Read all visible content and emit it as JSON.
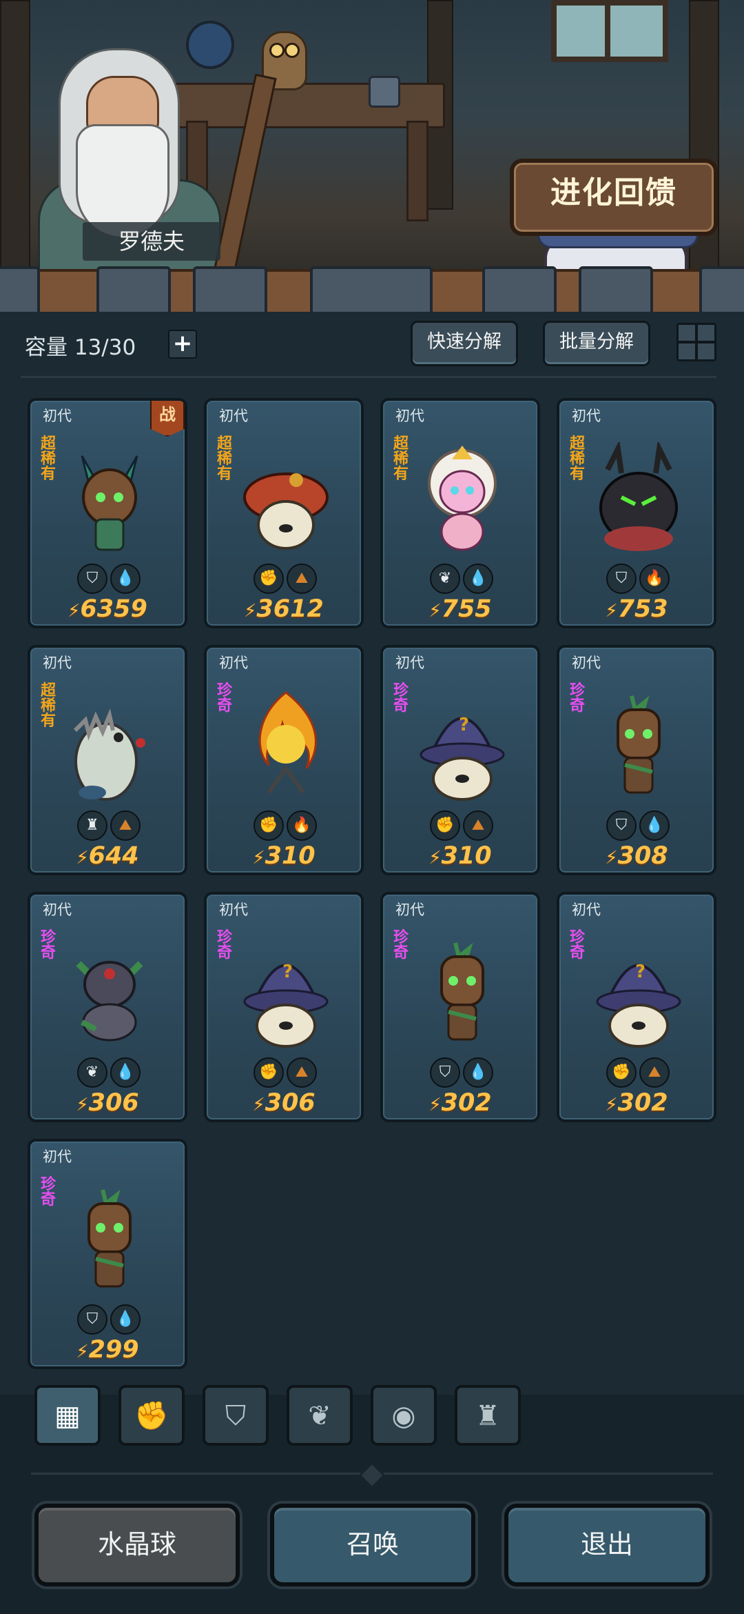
{
  "scene": {
    "npc_name": "罗德夫",
    "evolution_feedback_label": "进化回馈"
  },
  "toolbar": {
    "capacity_text": "容量 13/30",
    "plus_label": "+",
    "quick_dismantle_label": "快速分解",
    "batch_dismantle_label": "批量分解"
  },
  "cards": [
    {
      "generation": "初代",
      "rarity": "超稀有",
      "rarity_class": "r-super",
      "power": "6359",
      "in_battle": true,
      "battle_label": "战",
      "badges": [
        "shield-icon",
        "water-icon"
      ],
      "monster": "tree-knight"
    },
    {
      "generation": "初代",
      "rarity": "超稀有",
      "rarity_class": "r-super",
      "power": "3612",
      "in_battle": false,
      "badges": [
        "fist-icon",
        "earth-icon"
      ],
      "monster": "red-mushroom"
    },
    {
      "generation": "初代",
      "rarity": "超稀有",
      "rarity_class": "r-super",
      "power": "755",
      "in_battle": false,
      "badges": [
        "leaf-icon",
        "water-icon"
      ],
      "monster": "pink-larva"
    },
    {
      "generation": "初代",
      "rarity": "超稀有",
      "rarity_class": "r-super",
      "power": "753",
      "in_battle": false,
      "badges": [
        "shield-icon",
        "fire-icon"
      ],
      "monster": "dark-beast"
    },
    {
      "generation": "初代",
      "rarity": "超稀有",
      "rarity_class": "r-super",
      "power": "644",
      "in_battle": false,
      "badges": [
        "tower-icon",
        "earth-icon"
      ],
      "monster": "armored-rat"
    },
    {
      "generation": "初代",
      "rarity": "珍奇",
      "rarity_class": "r-rare",
      "power": "310",
      "in_battle": false,
      "badges": [
        "fist-icon",
        "fire-icon"
      ],
      "monster": "fire-spirit"
    },
    {
      "generation": "初代",
      "rarity": "珍奇",
      "rarity_class": "r-rare",
      "power": "310",
      "in_battle": false,
      "badges": [
        "fist-icon",
        "earth-icon"
      ],
      "monster": "wizard-mushroom"
    },
    {
      "generation": "初代",
      "rarity": "珍奇",
      "rarity_class": "r-rare",
      "power": "308",
      "in_battle": false,
      "badges": [
        "shield-icon",
        "water-icon"
      ],
      "monster": "sapling"
    },
    {
      "generation": "初代",
      "rarity": "珍奇",
      "rarity_class": "r-rare",
      "power": "306",
      "in_battle": false,
      "badges": [
        "leaf-icon",
        "water-icon"
      ],
      "monster": "green-larva"
    },
    {
      "generation": "初代",
      "rarity": "珍奇",
      "rarity_class": "r-rare",
      "power": "306",
      "in_battle": false,
      "badges": [
        "fist-icon",
        "earth-icon"
      ],
      "monster": "wizard-mushroom"
    },
    {
      "generation": "初代",
      "rarity": "珍奇",
      "rarity_class": "r-rare",
      "power": "302",
      "in_battle": false,
      "badges": [
        "shield-icon",
        "water-icon"
      ],
      "monster": "sapling"
    },
    {
      "generation": "初代",
      "rarity": "珍奇",
      "rarity_class": "r-rare",
      "power": "302",
      "in_battle": false,
      "badges": [
        "fist-icon",
        "earth-icon"
      ],
      "monster": "wizard-mushroom"
    },
    {
      "generation": "初代",
      "rarity": "珍奇",
      "rarity_class": "r-rare",
      "power": "299",
      "in_battle": false,
      "badges": [
        "shield-icon",
        "water-icon"
      ],
      "monster": "sapling"
    }
  ],
  "filter_tabs": [
    {
      "icon": "all-blocks-icon",
      "active": true
    },
    {
      "icon": "fist-icon",
      "active": false
    },
    {
      "icon": "shield-wings-icon",
      "active": false
    },
    {
      "icon": "sprout-icon",
      "active": false
    },
    {
      "icon": "egg-icon",
      "active": false
    },
    {
      "icon": "tower-icon",
      "active": false
    }
  ],
  "bottom_buttons": {
    "crystal_ball_label": "水晶球",
    "summon_label": "召唤",
    "exit_label": "退出"
  },
  "colors": {
    "super_rare": "#f3a51a",
    "rare": "#e64ef0",
    "power": "#ffc24a"
  }
}
